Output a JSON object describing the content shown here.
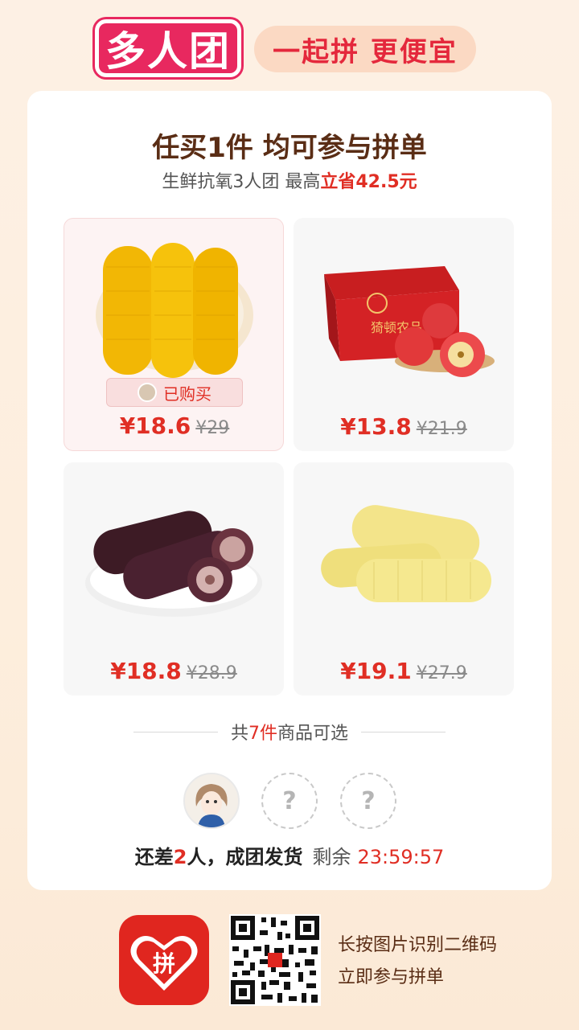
{
  "header": {
    "logo_text": "多人团",
    "slogan": "一起拼 更便宜"
  },
  "card": {
    "title": "任买1件 均可参与拼单",
    "subtitle_prefix": "生鲜抗氧3人团 最高",
    "subtitle_highlight": "立省42.5元"
  },
  "products": [
    {
      "name": "yellow-corn",
      "price": "¥18.6",
      "original_price": "¥29",
      "bought": true,
      "bought_label": "已购买"
    },
    {
      "name": "apple-box",
      "price": "¥13.8",
      "original_price": "¥21.9",
      "bought": false,
      "box_text": "猗顿农品"
    },
    {
      "name": "purple-corn",
      "price": "¥18.8",
      "original_price": "¥28.9",
      "bought": false
    },
    {
      "name": "white-corn",
      "price": "¥19.1",
      "original_price": "¥27.9",
      "bought": false
    }
  ],
  "summary": {
    "prefix": "共",
    "count": "7件",
    "suffix": "商品可选"
  },
  "group": {
    "empty_slot_symbol": "?",
    "status_prefix": "还差",
    "status_count": "2",
    "status_suffix": "人，成团发货",
    "remaining_label": "剩余",
    "countdown": "23:59:57"
  },
  "footer": {
    "app_icon_text": "拼",
    "hint_line1": "长按图片识别二维码",
    "hint_line2": "立即参与拼单"
  },
  "colors": {
    "accent_red": "#e02e24",
    "brand_pink": "#e8285f",
    "title_brown": "#5a2d15"
  }
}
